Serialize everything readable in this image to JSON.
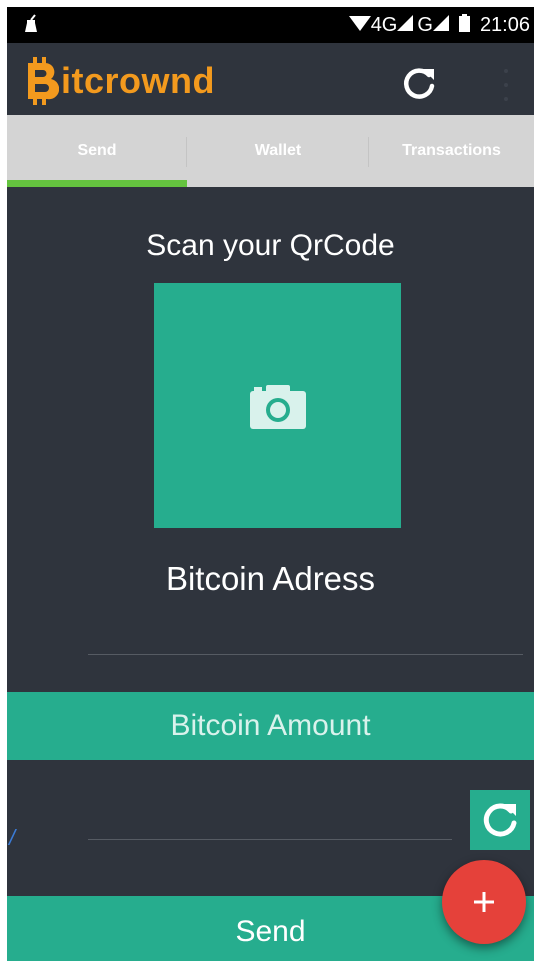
{
  "status_bar": {
    "network_1": "4G",
    "network_2": "G",
    "time": "21:06",
    "icons": [
      "cleaner-icon",
      "wifi-icon",
      "signal-icon",
      "battery-icon"
    ]
  },
  "app_bar": {
    "logo_initial": "B",
    "logo_text": "itcrownd",
    "brand_color": "#f39a1e",
    "refresh_icon": "refresh-icon",
    "overflow_icon": "overflow-menu-icon"
  },
  "tabs": [
    {
      "label": "Send",
      "selected": true
    },
    {
      "label": "Wallet",
      "selected": false
    },
    {
      "label": "Transactions",
      "selected": false
    }
  ],
  "main": {
    "scan_title": "Scan your QrCode",
    "camera_icon": "camera-icon",
    "address_label": "Bitcoin Adress",
    "address_value": "",
    "amount_label": "Bitcoin Amount",
    "amount_value": "",
    "amount_refresh_icon": "refresh-icon",
    "send_label": "Send",
    "fab_icon": "plus-icon"
  },
  "colors": {
    "background": "#2f343d",
    "accent": "#26ad8e",
    "tab_indicator": "#64c33f",
    "fab": "#e5413a"
  }
}
